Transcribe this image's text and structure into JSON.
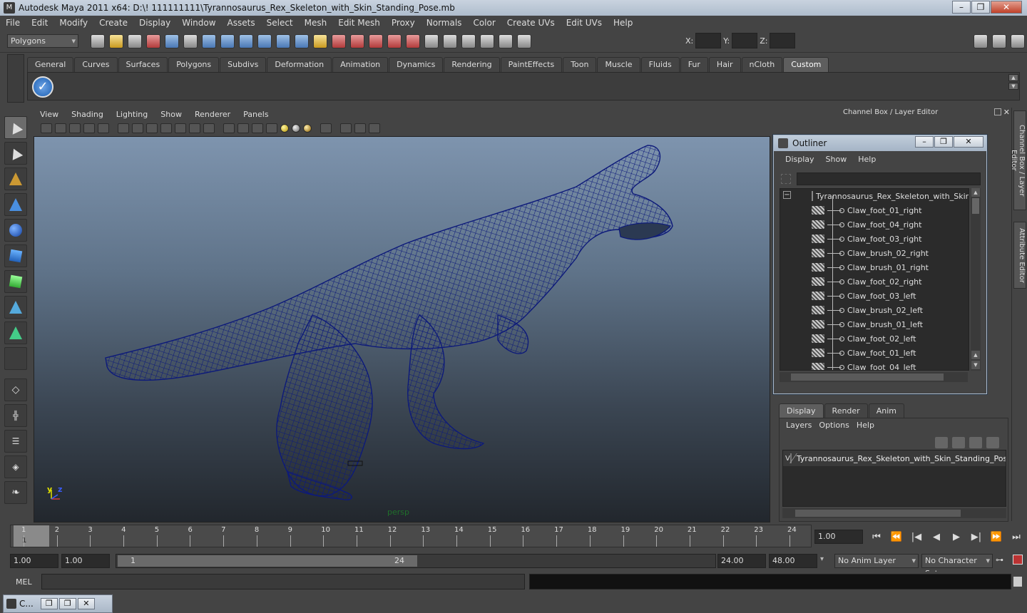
{
  "window": {
    "title": "Autodesk Maya 2011 x64: D:\\! 111111111\\Tyrannosaurus_Rex_Skeleton_with_Skin_Standing_Pose.mb",
    "minimize": "–",
    "maximize": "❐",
    "close": "✕"
  },
  "menubar": [
    "File",
    "Edit",
    "Modify",
    "Create",
    "Display",
    "Window",
    "Assets",
    "Select",
    "Mesh",
    "Edit Mesh",
    "Proxy",
    "Normals",
    "Color",
    "Create UVs",
    "Edit UVs",
    "Help"
  ],
  "toolbar": {
    "mode": "Polygons",
    "x_label": "X:",
    "y_label": "Y:",
    "z_label": "Z:"
  },
  "shelf": {
    "tabs": [
      "General",
      "Curves",
      "Surfaces",
      "Polygons",
      "Subdivs",
      "Deformation",
      "Animation",
      "Dynamics",
      "Rendering",
      "PaintEffects",
      "Toon",
      "Muscle",
      "Fluids",
      "Fur",
      "Hair",
      "nCloth",
      "Custom"
    ],
    "active_tab": "Custom",
    "check_glyph": "✓"
  },
  "viewport": {
    "menu": [
      "View",
      "Shading",
      "Lighting",
      "Show",
      "Renderer",
      "Panels"
    ],
    "camera_label": "persp",
    "axis_y": "y",
    "axis_z": "z",
    "axis_x_color": "#d23c3c",
    "axis_y_color": "#e0e000",
    "axis_z_color": "#3a5bff",
    "wire_color": "#0d1a7a"
  },
  "channel_box": {
    "title": "Channel Box / Layer Editor"
  },
  "side_tabs": {
    "channel_box": "Channel Box / Layer Editor",
    "attribute_editor": "Attribute Editor"
  },
  "outliner": {
    "title": "Outliner",
    "menu": [
      "Display",
      "Show",
      "Help"
    ],
    "root": "Tyrannosaurus_Rex_Skeleton_with_Skin",
    "items": [
      "Claw_foot_01_right",
      "Claw_foot_04_right",
      "Claw_foot_03_right",
      "Claw_brush_02_right",
      "Claw_brush_01_right",
      "Claw_foot_02_right",
      "Claw_foot_03_left",
      "Claw_brush_02_left",
      "Claw_brush_01_left",
      "Claw_foot_02_left",
      "Claw_foot_01_left",
      "Claw_foot_04_left"
    ]
  },
  "layer_editor": {
    "tabs": [
      "Display",
      "Render",
      "Anim"
    ],
    "active_tab": "Display",
    "menu": [
      "Layers",
      "Options",
      "Help"
    ],
    "layers": [
      {
        "visible": "V",
        "name": "Tyrannosaurus_Rex_Skeleton_with_Skin_Standing_Pose"
      }
    ]
  },
  "timeline": {
    "ticks": [
      "1",
      "2",
      "3",
      "4",
      "5",
      "6",
      "7",
      "8",
      "9",
      "10",
      "11",
      "12",
      "13",
      "14",
      "15",
      "16",
      "17",
      "18",
      "19",
      "20",
      "21",
      "22",
      "23",
      "24"
    ],
    "current_frame": "1",
    "current_time": "1.00",
    "playback": [
      "⏮",
      "⏪",
      "|◀",
      "◀",
      "▶",
      "▶|",
      "⏩",
      "⏭"
    ]
  },
  "range": {
    "start": "1.00",
    "inner_start": "1.00",
    "slider_start": "1",
    "slider_end": "24",
    "end": "24.00",
    "outer_end": "48.00",
    "anim_layer": "No Anim Layer",
    "character_set": "No Character Set"
  },
  "command": {
    "label": "MEL"
  },
  "minimized": {
    "label": "C..."
  }
}
